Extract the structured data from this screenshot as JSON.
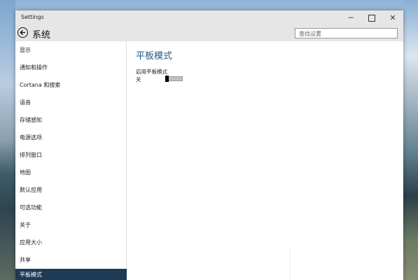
{
  "window": {
    "title": "Settings",
    "controls": {
      "minimize": "─",
      "maximize": "",
      "close": "✕"
    }
  },
  "header": {
    "title": "系统",
    "search_placeholder": "查找设置"
  },
  "sidebar": {
    "items": [
      {
        "label": "显示"
      },
      {
        "label": "通知和操作"
      },
      {
        "label": "Cortana 和搜索"
      },
      {
        "label": "语音"
      },
      {
        "label": "存储感知"
      },
      {
        "label": "电源选项"
      },
      {
        "label": "排列窗口"
      },
      {
        "label": "地图"
      },
      {
        "label": "默认应用"
      },
      {
        "label": "可选功能"
      },
      {
        "label": "关于"
      },
      {
        "label": "应用大小"
      },
      {
        "label": "共享"
      },
      {
        "label": "平板模式",
        "selected": true
      }
    ]
  },
  "content": {
    "title": "平板模式",
    "setting_label": "启用平板模式",
    "toggle_state": "关",
    "toggle_on": false
  },
  "colors": {
    "accent_title": "#1f5a86",
    "selected_bg": "#1e3a55",
    "titlebar_bg": "#e6e6e6"
  }
}
